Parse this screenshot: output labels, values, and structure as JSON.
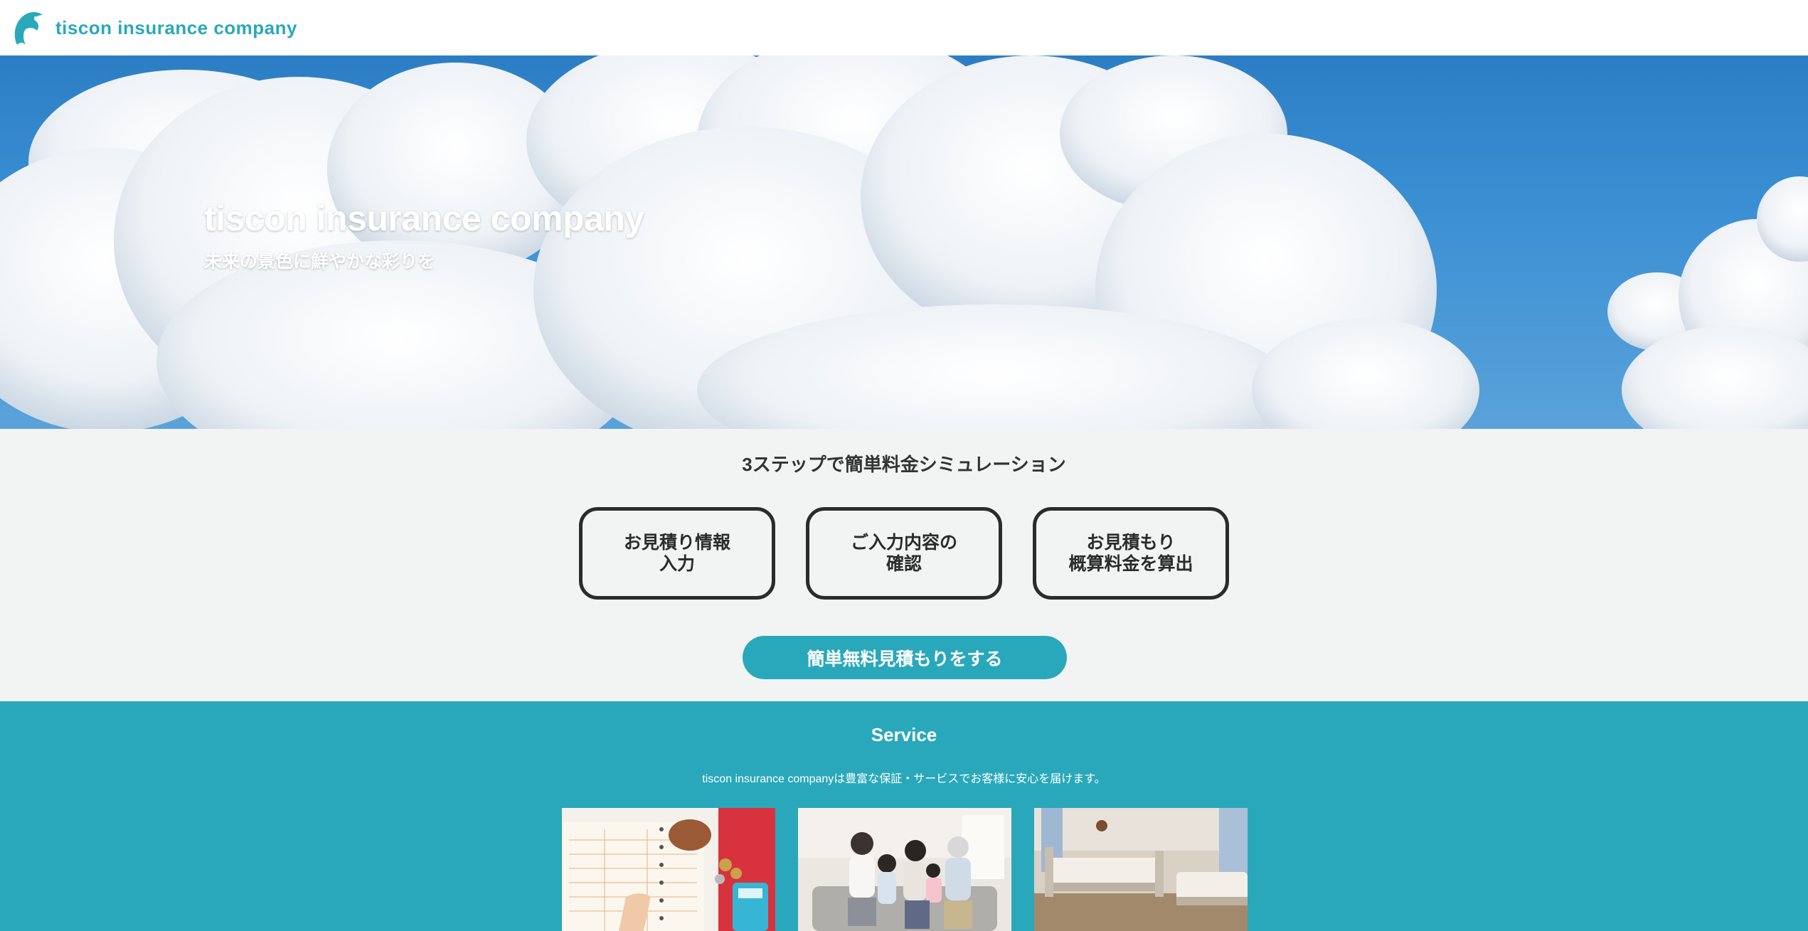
{
  "header": {
    "brand": "tiscon insurance company",
    "logo_icon": "dolphin-icon"
  },
  "hero": {
    "title": "tiscon insurance company",
    "subtitle": "未来の景色に鮮やかな彩りを"
  },
  "simulation": {
    "title": "3ステップで簡単料金シミュレーション",
    "steps": [
      {
        "label": "お見積り情報\n入力"
      },
      {
        "label": "ご入力内容の\n確認"
      },
      {
        "label": "お見積もり\n概算料金を算出"
      }
    ],
    "cta_label": "簡単無料見積もりをする"
  },
  "service": {
    "title": "Service",
    "description": "tiscon insurance companyは豊富な保証・サービスでお客様に安心を届けます。",
    "cards": [
      "calculator-image",
      "family-image",
      "hospital-bed-image"
    ]
  },
  "colors": {
    "accent": "#2aa8bb",
    "sky": "#3a8fd3",
    "background": "#f2f4f4"
  }
}
